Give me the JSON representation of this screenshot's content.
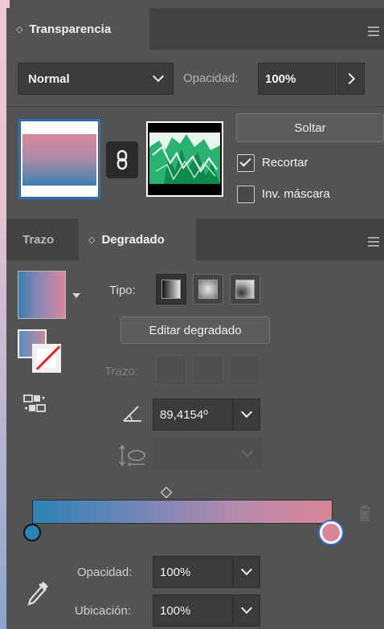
{
  "transparency_panel": {
    "tab_label": "Transparencia",
    "blend_mode": "Normal",
    "opacity_label": "Opacidad:",
    "opacity_value": "100%",
    "release_button": "Soltar",
    "clip_label": "Recortar",
    "clip_checked": true,
    "invert_mask_label": "Inv. máscara",
    "invert_mask_checked": false
  },
  "gradient_panel": {
    "tabs": [
      {
        "label": "Trazo",
        "active": false
      },
      {
        "label": "Degradado",
        "active": true
      }
    ],
    "type_label": "Tipo:",
    "type_options": [
      "linear",
      "radial",
      "freeform"
    ],
    "type_selected": "linear",
    "edit_button": "Editar degradado",
    "stroke_label": "Trazo:",
    "angle_value": "89,4154º",
    "stop_opacity_label": "Opacidad:",
    "stop_opacity_value": "100%",
    "stop_location_label": "Ubicación:",
    "stop_location_value": "100%",
    "gradient_colors": [
      "#2b83b5",
      "#d98597"
    ],
    "selected_stop": "right"
  },
  "icons": [
    "chevron-down-icon",
    "chevron-right-icon",
    "link-icon",
    "menu-icon",
    "trash-icon",
    "eyedropper-icon",
    "angle-icon",
    "aspect-ratio-icon",
    "reverse-gradient-icon"
  ]
}
